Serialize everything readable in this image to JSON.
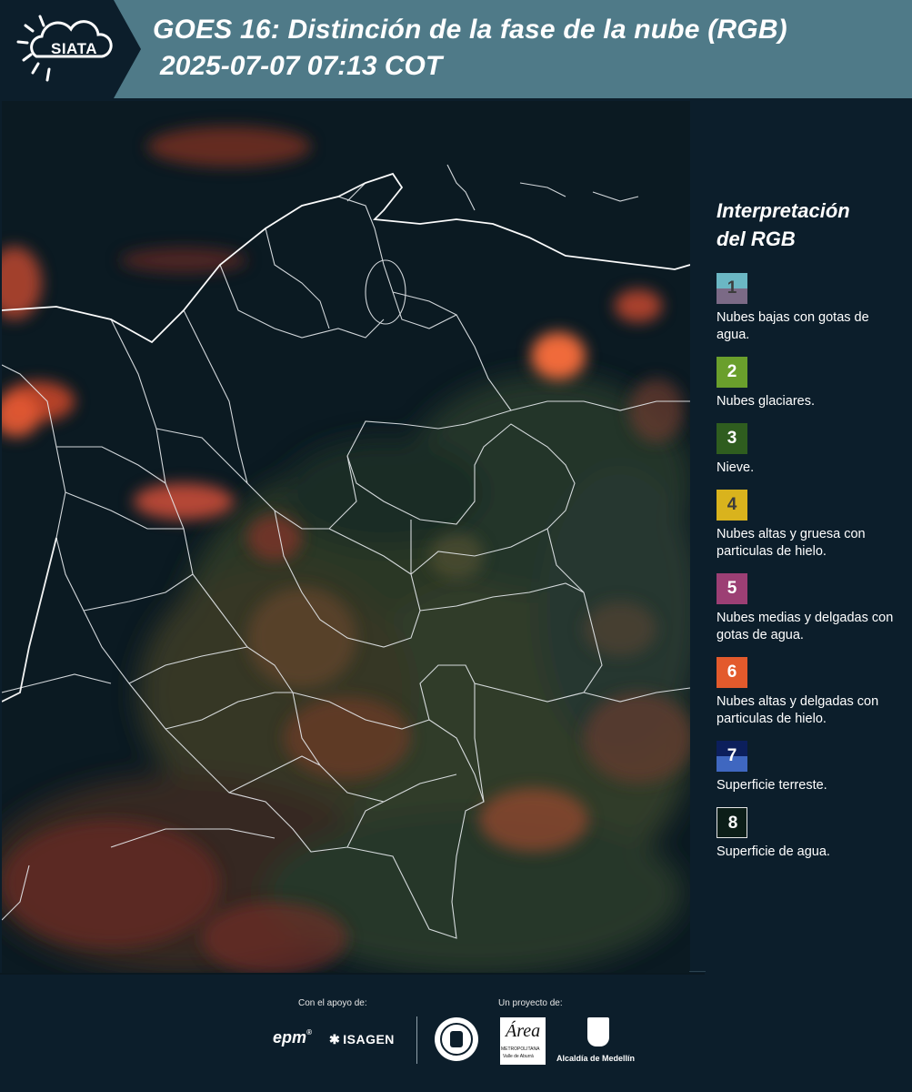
{
  "header": {
    "logo_text": "SIATA",
    "title_line1": "GOES 16: Distinción de la fase de la nube (RGB)",
    "title_line2": "2025-07-07 07:13 COT",
    "colors": {
      "header_bg": "#4f7a88",
      "logo_bg": "#0c1e2b"
    }
  },
  "legend": {
    "title_line1": "Interpretación",
    "title_line2": "del RGB",
    "items": [
      {
        "number": "1",
        "label": "Nubes bajas con gotas de agua.",
        "color_top": "#6bb7c4",
        "color_bottom": "#7b6a86"
      },
      {
        "number": "2",
        "label": "Nubes glaciares.",
        "color": "#6a9f2c"
      },
      {
        "number": "3",
        "label": "Nieve.",
        "color": "#2f5d1f"
      },
      {
        "number": "4",
        "label": "Nubes altas y gruesa con particulas de hielo.",
        "color": "#d9b31d"
      },
      {
        "number": "5",
        "label": "Nubes medias y delgadas con gotas de agua.",
        "color": "#9c3f74"
      },
      {
        "number": "6",
        "label": "Nubes altas y delgadas con particulas de hielo.",
        "color": "#e35a2c"
      },
      {
        "number": "7",
        "label": "Superficie terreste.",
        "color_top": "#0c1f5c",
        "color_bottom": "#3f67c0"
      },
      {
        "number": "8",
        "label": "Superficie de agua.",
        "color": "#0c1e18"
      }
    ]
  },
  "footer": {
    "support_label": "Con el apoyo de:",
    "project_label": "Un proyecto de:",
    "logos": [
      "epm",
      "ISAGEN",
      "Área Metropolitana",
      "Alcaldía de Medellín"
    ],
    "epm_text": "epm",
    "isagen_text": "ISAGEN",
    "area_text": "Área",
    "area_sub": "METROPOLITANA",
    "area_sub2": "Valle de Aburrá",
    "alcaldia_text": "Alcaldía de Medellín"
  }
}
